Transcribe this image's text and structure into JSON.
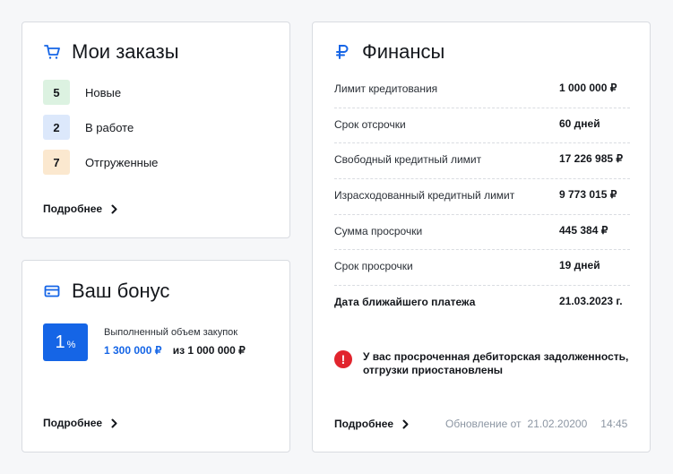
{
  "colors": {
    "accent": "#1565e6",
    "new_bg": "#dcf2e1",
    "in_work_bg": "#dce8fb",
    "shipped_bg": "#fbe8cf",
    "alert": "#e1242d",
    "muted": "#8c96a3"
  },
  "orders": {
    "icon": "cart-icon",
    "title": "Мои заказы",
    "rows": [
      {
        "count": "5",
        "label": "Новые"
      },
      {
        "count": "2",
        "label": "В работе"
      },
      {
        "count": "7",
        "label": "Отгруженные"
      }
    ],
    "more": "Подробнее"
  },
  "bonus": {
    "icon": "card-icon",
    "title": "Ваш бонус",
    "percent": "1",
    "percent_sign": "%",
    "caption": "Выполненный объем закупок",
    "done": "1 300 000 ₽",
    "of": "из 1 000 000 ₽",
    "more": "Подробнее"
  },
  "finance": {
    "icon": "ruble-icon",
    "title": "Финансы",
    "rows": [
      {
        "label": "Лимит кредитования",
        "value": "1 000 000 ₽"
      },
      {
        "label": "Срок отсрочки",
        "value": "60 дней"
      },
      {
        "label": "Свободный кредитный лимит",
        "value": "17 226 985 ₽"
      },
      {
        "label": "Израсходованный кредитный лимит",
        "value": "9 773 015 ₽"
      },
      {
        "label": "Сумма просрочки",
        "value": "445 384 ₽"
      },
      {
        "label": "Срок просрочки",
        "value": "19 дней"
      },
      {
        "label": "Дата ближайшего платежа",
        "value": "21.03.2023 г."
      }
    ],
    "alert_line1": "У вас просроченная дебиторская задолженность,",
    "alert_line2": "отгрузки приостановлены",
    "more": "Подробнее",
    "update_label": "Обновление от",
    "update_date": "21.02.20200",
    "update_time": "14:45"
  }
}
